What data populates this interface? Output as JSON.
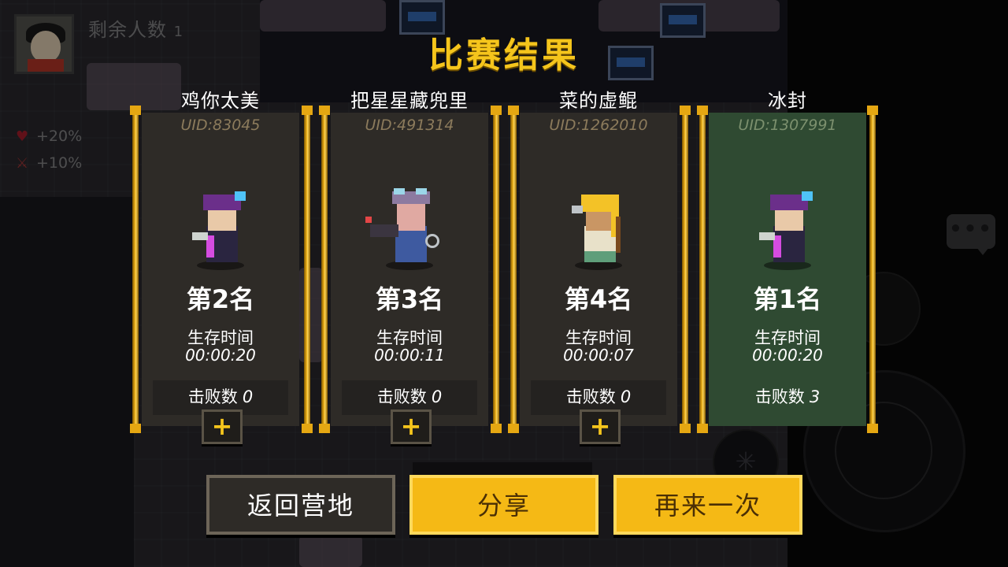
{
  "hud": {
    "remaining_label": "剩余人数",
    "remaining_count": "1",
    "hp_bonus": "+20%",
    "atk_bonus": "+10%",
    "chat_icon": "chat-bubble-icon"
  },
  "result": {
    "title": "比赛结果",
    "players": [
      {
        "name": "鸡你太美",
        "uid": "UID:83045",
        "rank_prefix": "第",
        "rank_num": "2",
        "rank_suffix": "名",
        "survive_label": "生存时间",
        "survive_time": "00:00:20",
        "kills_label": "击败数",
        "kills": "0",
        "winner": false,
        "character": "purple-hood-assassin"
      },
      {
        "name": "把星星藏兜里",
        "uid": "UID:491314",
        "rank_prefix": "第",
        "rank_num": "3",
        "rank_suffix": "名",
        "survive_label": "生存时间",
        "survive_time": "00:00:11",
        "kills_label": "击败数",
        "kills": "0",
        "winner": false,
        "character": "goggles-engineer"
      },
      {
        "name": "菜的虚鲲",
        "uid": "UID:1262010",
        "rank_prefix": "第",
        "rank_num": "4",
        "rank_suffix": "名",
        "survive_label": "生存时间",
        "survive_time": "00:00:07",
        "kills_label": "击败数",
        "kills": "0",
        "winner": false,
        "character": "blonde-elf-archer"
      },
      {
        "name": "冰封",
        "uid": "UID:1307991",
        "rank_prefix": "第",
        "rank_num": "1",
        "rank_suffix": "名",
        "survive_label": "生存时间",
        "survive_time": "00:00:20",
        "kills_label": "击败数",
        "kills": "3",
        "winner": true,
        "character": "purple-hood-assassin"
      }
    ],
    "add_friend_icon": "plus-icon"
  },
  "buttons": {
    "back_label": "返回营地",
    "share_label": "分享",
    "again_label": "再来一次"
  },
  "colors": {
    "title_gold": "#f5c51c",
    "card_bg": "#2e2b27",
    "winner_bg": "#2f4a32",
    "button_gold": "#f5b915"
  }
}
